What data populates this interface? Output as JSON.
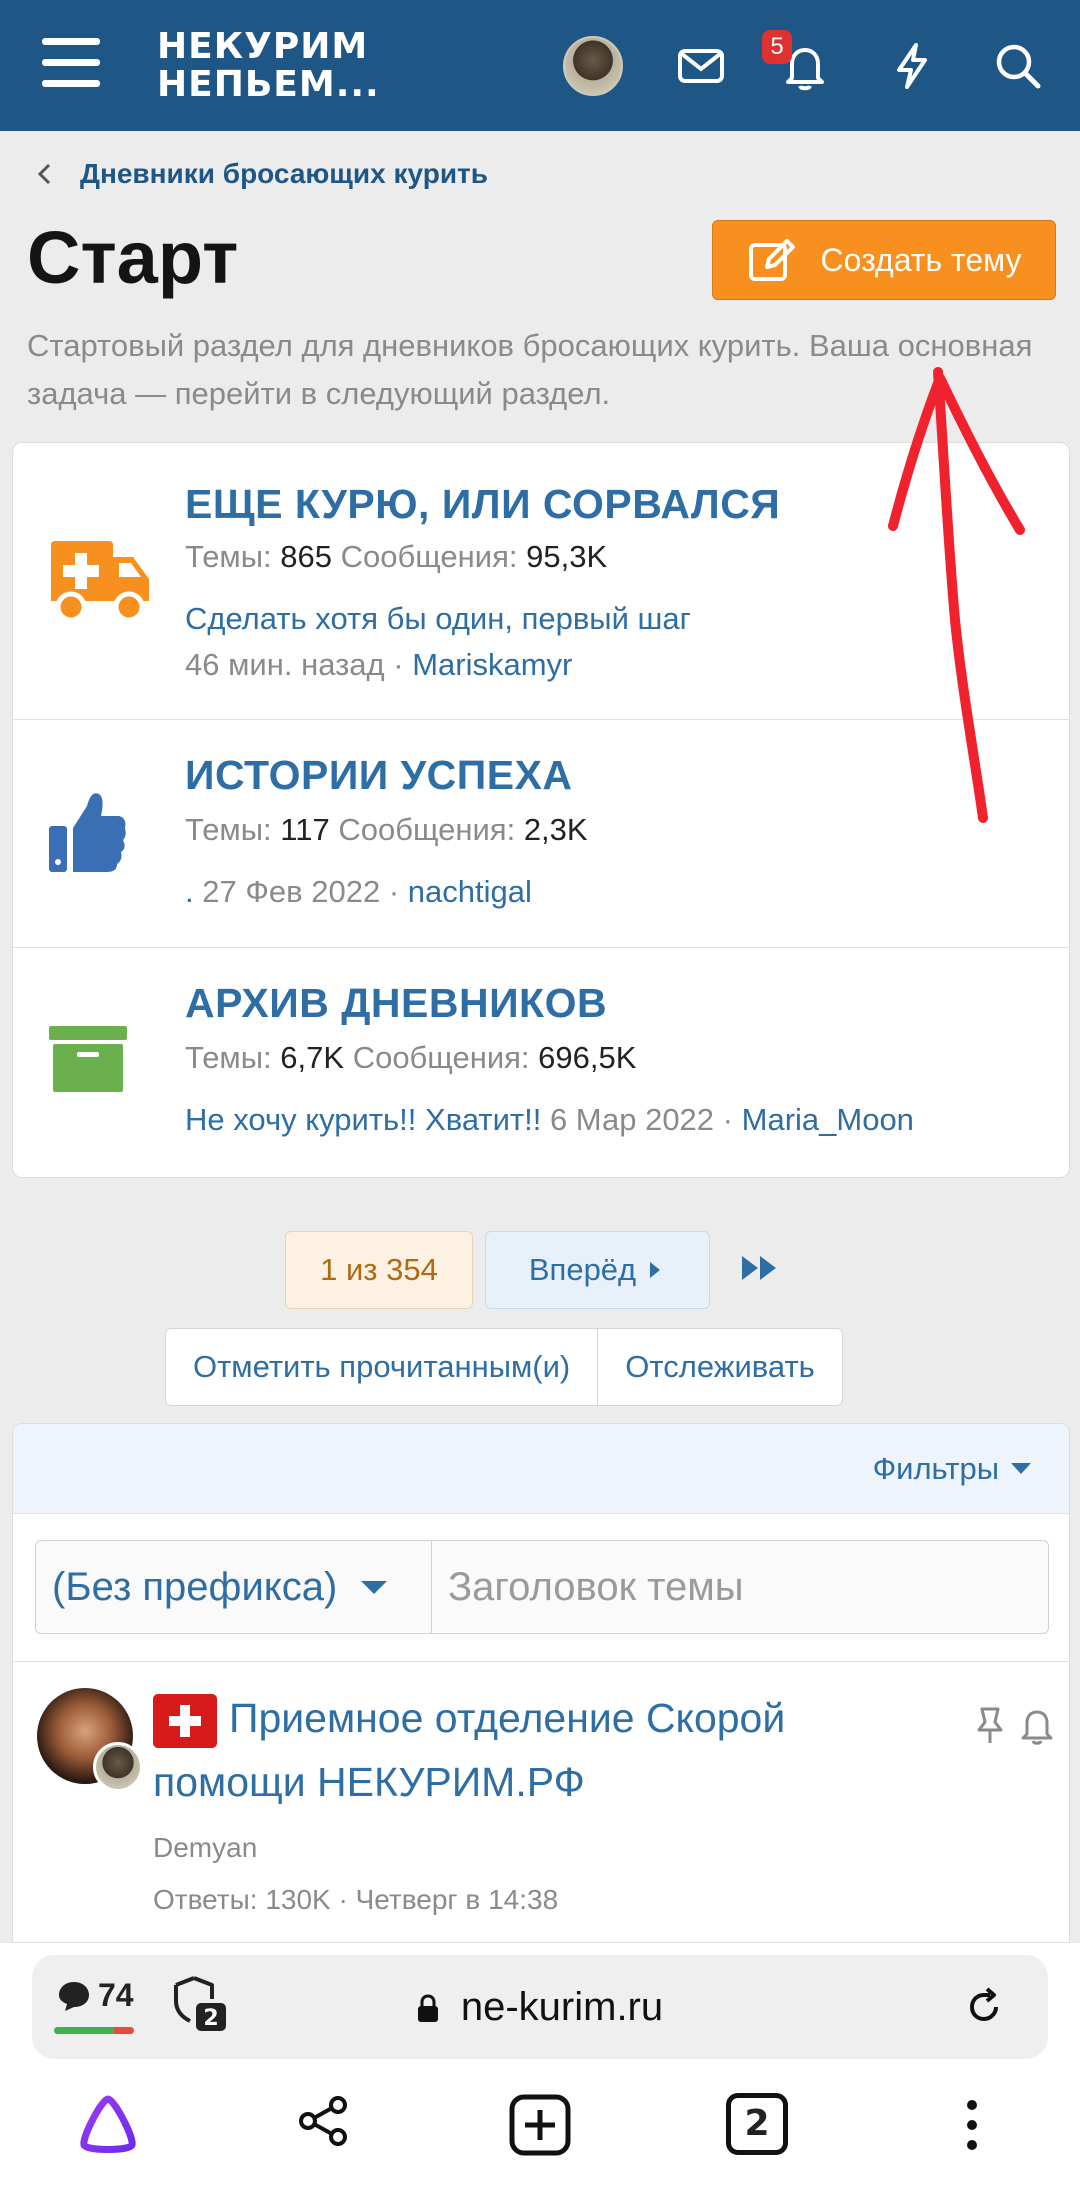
{
  "header": {
    "logo_line1": "НЕКУРИМ",
    "logo_line2": "НЕПЬЕМ...",
    "alerts_badge": "5",
    "icons": [
      "menu-icon",
      "avatar",
      "mail-icon",
      "bell-icon",
      "lightning-icon",
      "search-icon"
    ],
    "bg_color": "#1e5686"
  },
  "breadcrumb": {
    "label": "Дневники бросающих курить"
  },
  "page": {
    "title": "Старт",
    "create_button": "Создать тему",
    "description": "Стартовый раздел для дневников бросающих курить. Ваша основная задача — перейти в следующий раздел."
  },
  "nodes": [
    {
      "title": "ЕЩЕ КУРЮ, ИЛИ СОРВАЛСЯ",
      "themes_label": "Темы:",
      "themes": "865",
      "posts_label": "Сообщения:",
      "posts": "95,3K",
      "last_title": "Сделать хотя бы один, первый шаг",
      "last_time": "46 мин. назад",
      "sep": "·",
      "last_user": "Mariskamyr",
      "icon": "ambulance-icon",
      "icon_color": "#f7901e"
    },
    {
      "title": "ИСТОРИИ УСПЕХА",
      "themes_label": "Темы:",
      "themes": "117",
      "posts_label": "Сообщения:",
      "posts": "2,3K",
      "last_title": ".",
      "last_time": "27 Фев 2022",
      "sep": "·",
      "last_user": "nachtigal",
      "icon": "thumbs-up-icon",
      "icon_color": "#3b6fb5"
    },
    {
      "title": "АРХИВ ДНЕВНИКОВ",
      "themes_label": "Темы:",
      "themes": "6,7K",
      "posts_label": "Сообщения:",
      "posts": "696,5K",
      "last_title": "Не хочу курить!! Хватит!!",
      "last_time": "6 Мар 2022",
      "sep": "·",
      "last_user": "Maria_Moon",
      "icon": "archive-box-icon",
      "icon_color": "#6ab04c"
    }
  ],
  "pager": {
    "current": "1 из 354",
    "next": "Вперёд"
  },
  "actions": {
    "mark_read": "Отметить прочитанным(и)",
    "watch": "Отслеживать"
  },
  "filters": {
    "label": "Фильтры",
    "prefix_value": "(Без префикса)",
    "title_placeholder": "Заголовок темы"
  },
  "thread": {
    "title": "Приемное отделение Скорой помощи НЕКУРИМ.РФ",
    "author": "Demyan",
    "meta": "Ответы: 130K · Четверг в 14:38",
    "prefix_icon": "red-cross-icon"
  },
  "browser": {
    "tab_count": "74",
    "shield_count": "2",
    "url": "ne-kurim.ru",
    "tabs_count": "2",
    "count_bar_green_fraction": 0.75
  },
  "annotation": {
    "color": "#f0222e"
  }
}
